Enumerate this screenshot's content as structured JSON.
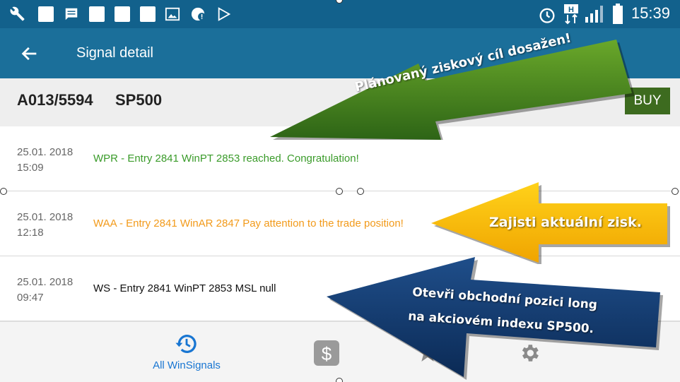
{
  "status_bar": {
    "time": "15:39",
    "left_icons": [
      "wrench-icon",
      "square-icon",
      "message-icon",
      "square-icon",
      "square-icon",
      "square-icon",
      "image-icon",
      "alert-icon",
      "play-store-icon"
    ],
    "right_icons": [
      "alarm-icon",
      "h-signal-icon",
      "signal-bars-icon",
      "battery-icon"
    ]
  },
  "app_bar": {
    "title": "Signal detail"
  },
  "signal": {
    "id": "A013/5594",
    "symbol": "SP500",
    "action": "BUY"
  },
  "rows": [
    {
      "date": "25.01. 2018",
      "time": "15:09",
      "message": "WPR - Entry 2841 WinPT 2853 reached. Congratulation!",
      "color": "#3a9b2a"
    },
    {
      "date": "25.01. 2018",
      "time": "12:18",
      "message": "WAA - Entry 2841 WinAR 2847 Pay attention to the trade position!",
      "color": "#f29a1a"
    },
    {
      "date": "25.01. 2018",
      "time": "09:47",
      "message": "WS - Entry 2841 WinPT 2853 MSL null",
      "color": "#111111"
    }
  ],
  "bottom_nav": {
    "items": [
      {
        "label": "All WinSignals",
        "icon": "history-icon"
      },
      {
        "label": "",
        "icon": "dollar-icon"
      },
      {
        "label": "",
        "icon": "star-icon"
      },
      {
        "label": "",
        "icon": "gear-icon"
      }
    ]
  },
  "annotations": {
    "green": "Plánovaný ziskový cíl dosažen!",
    "yellow": "Zajisti aktuální zisk.",
    "blue_line1": "Otevři obchodní pozici long",
    "blue_line2": "na akciovém indexu SP500."
  },
  "colors": {
    "status_bar": "#12618c",
    "app_bar": "#1b6f9a",
    "buy": "#3d6b1f",
    "accent": "#1976d2"
  }
}
